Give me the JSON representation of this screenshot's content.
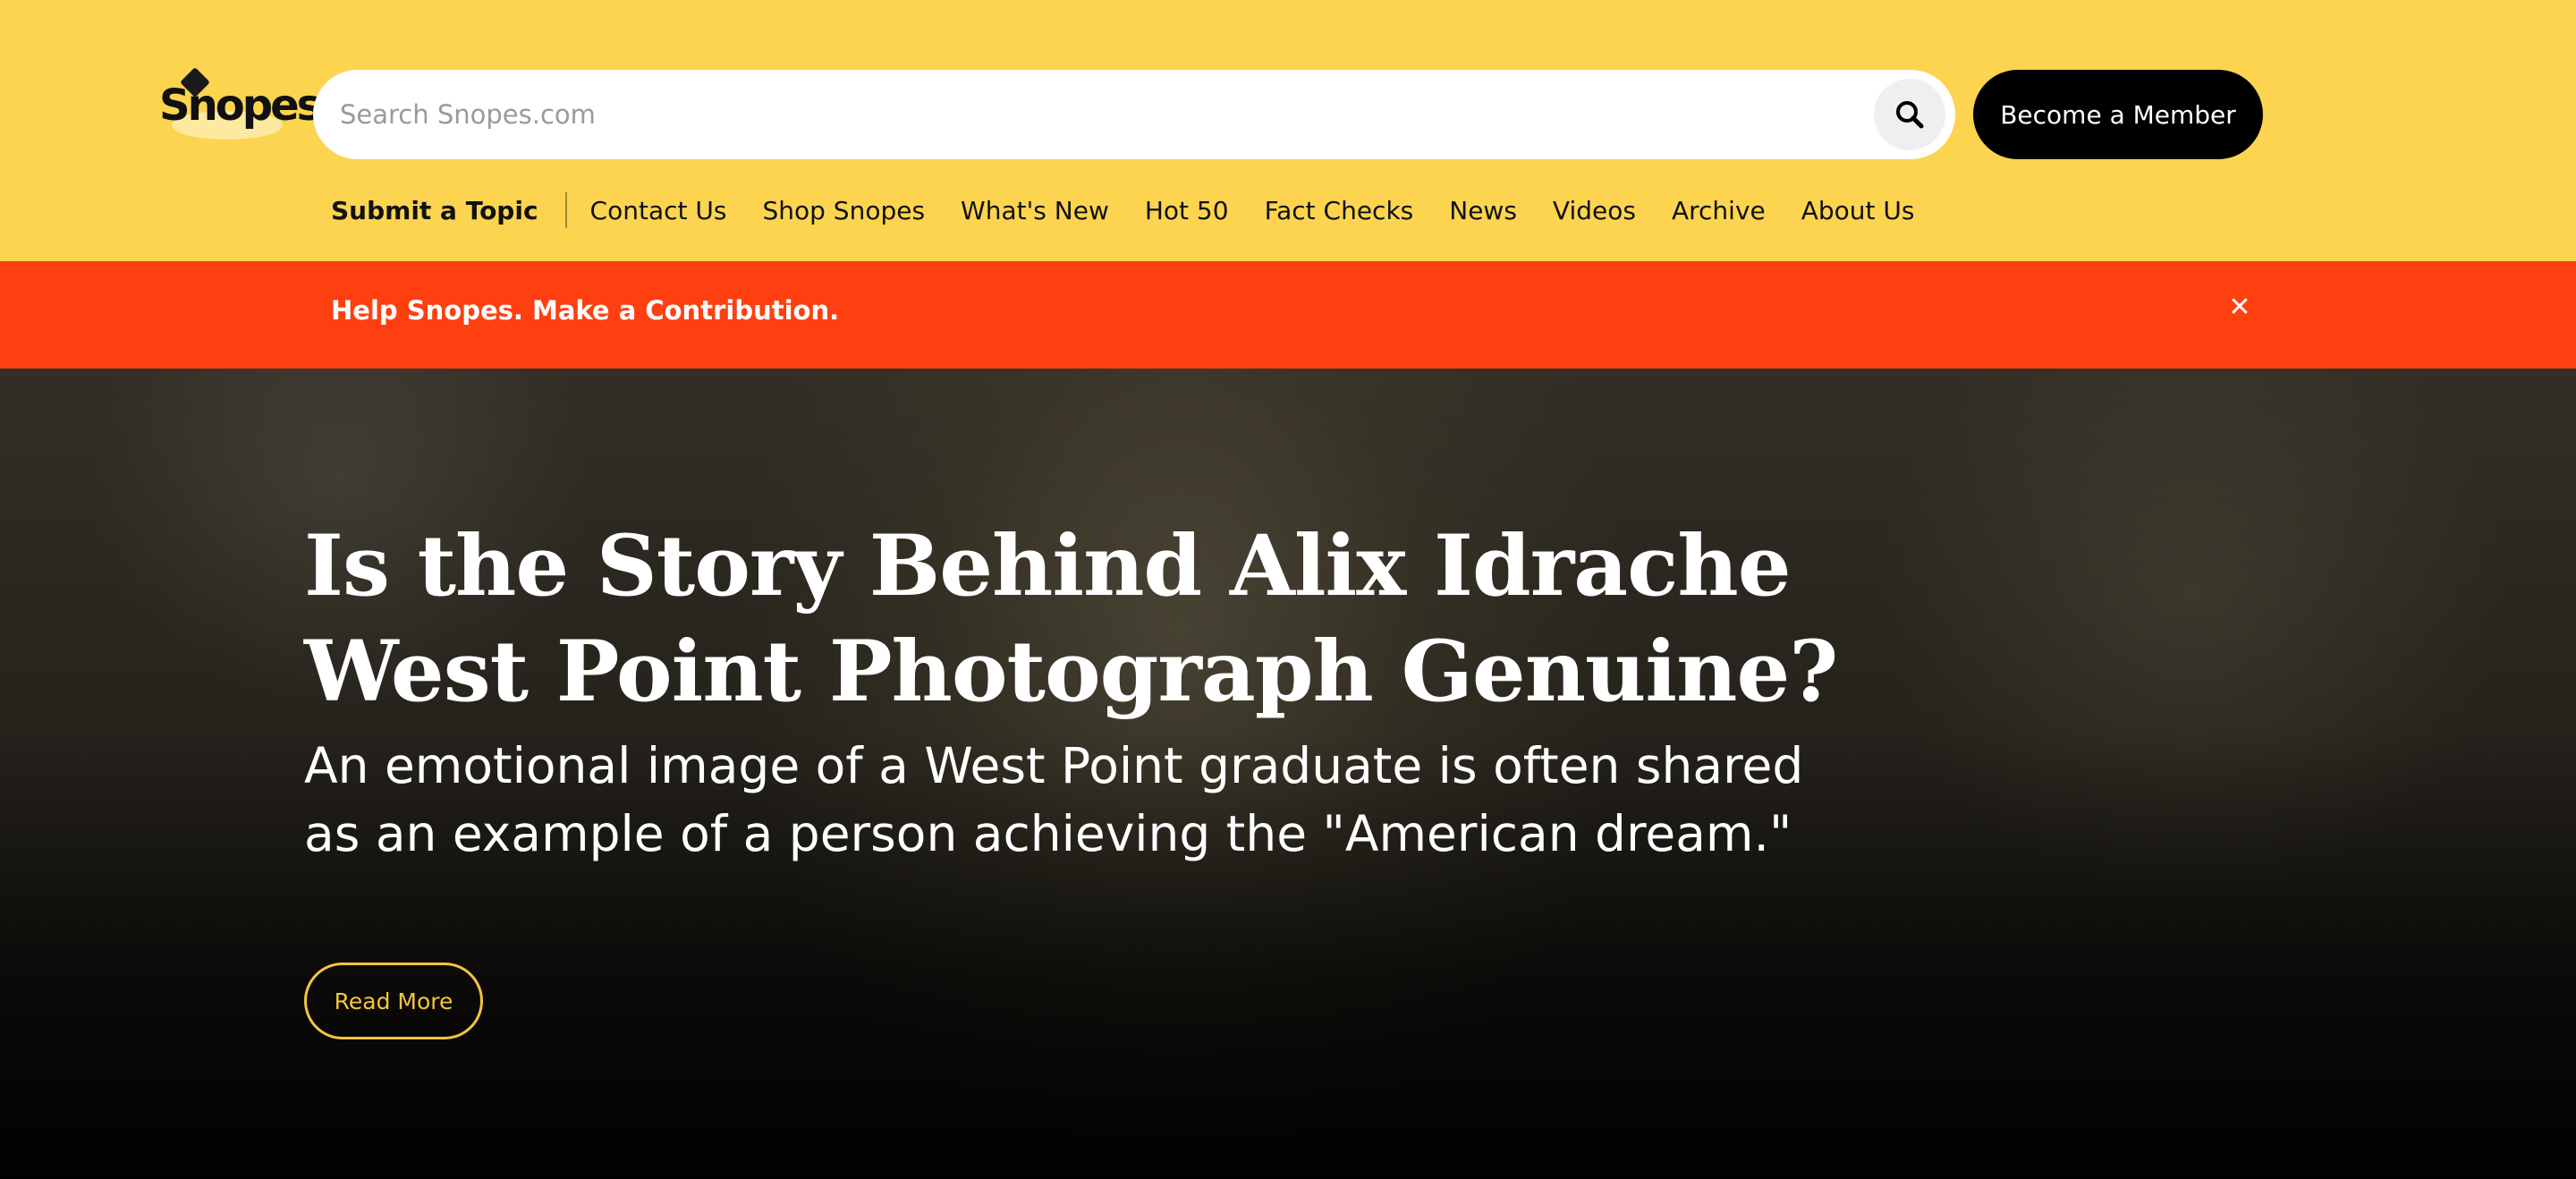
{
  "header": {
    "logo_text": "Snopes",
    "search": {
      "placeholder": "Search Snopes.com"
    },
    "member_button": "Become a Member",
    "nav": [
      "Submit a Topic",
      "Contact Us",
      "Shop Snopes",
      "What's New",
      "Hot 50",
      "Fact Checks",
      "News",
      "Videos",
      "Archive",
      "About Us"
    ]
  },
  "banner": {
    "text": "Help Snopes. Make a Contribution.",
    "close_icon": "close-icon"
  },
  "hero": {
    "title": "Is the Story Behind Alix Idrache West Point Photograph Genuine?",
    "subtitle": "An emotional image of a West Point graduate is often shared as an example of a person achieving the \"American dream.\"",
    "button": "Read More"
  },
  "colors": {
    "header_bg": "#fcd450",
    "banner_bg": "#fe4010",
    "accent": "#f3c53e",
    "button_dark": "#000000"
  },
  "icons": [
    "search-icon",
    "close-icon",
    "snopes-logo"
  ]
}
